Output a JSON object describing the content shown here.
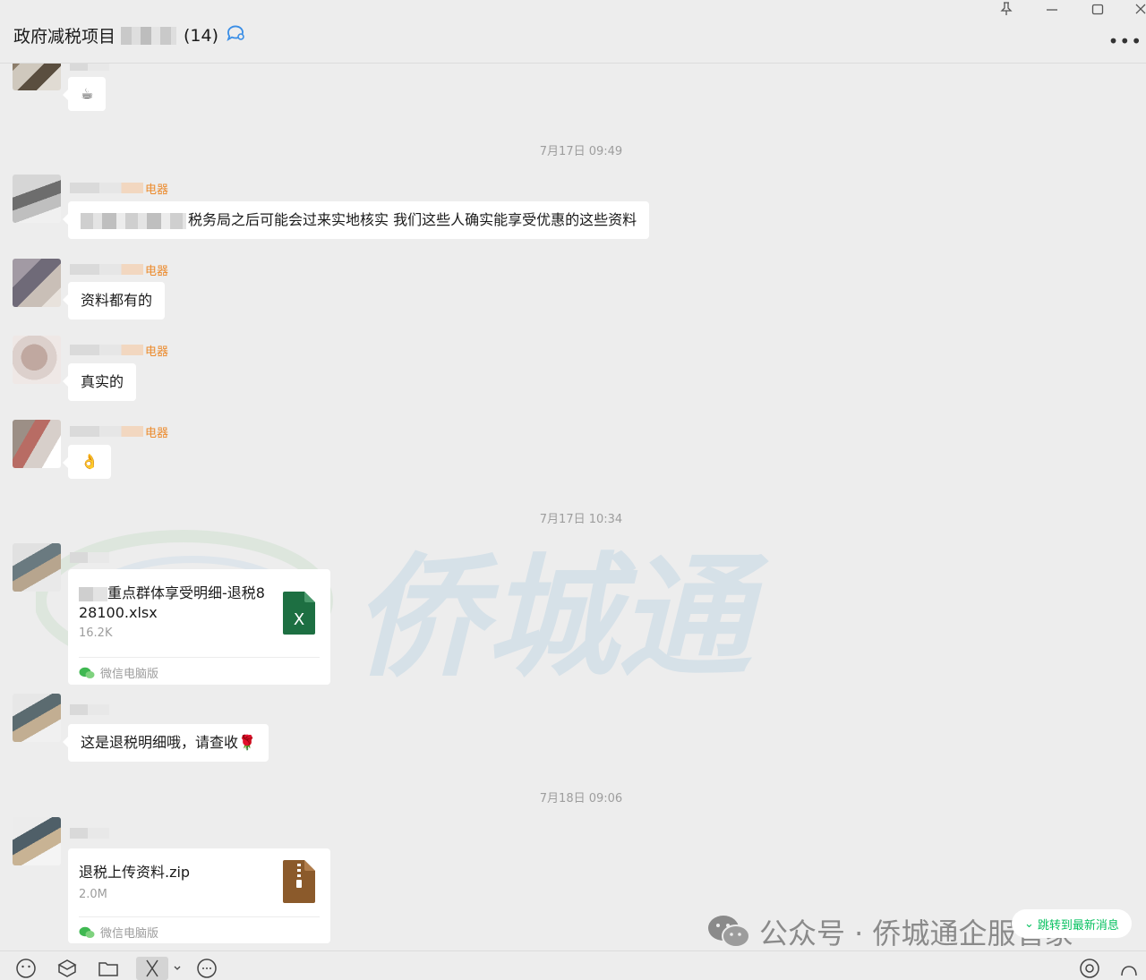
{
  "header": {
    "title_prefix": "政府减税项目",
    "member_count": "(14)"
  },
  "messages": [
    {
      "type": "emoji",
      "content": "☕"
    },
    {
      "type": "timestamp",
      "text": "7月17日 09:49"
    },
    {
      "type": "text",
      "nickname_suffix": "电器",
      "content": "税务局之后可能会过来实地核实 我们这些人确实能享受优惠的这些资料"
    },
    {
      "type": "text",
      "nickname_suffix": "电器",
      "content": "资料都有的"
    },
    {
      "type": "text",
      "nickname_suffix": "电器",
      "content": "真实的"
    },
    {
      "type": "emoji",
      "nickname_suffix": "电器",
      "content": "👌"
    },
    {
      "type": "timestamp",
      "text": "7月17日 10:34"
    },
    {
      "type": "file",
      "file_name": "重点群体享受明细-退税828100.xlsx",
      "file_size": "16.2K",
      "source": "微信电脑版",
      "file_type": "excel-icon",
      "file_badge": "X"
    },
    {
      "type": "text",
      "content": "这是退税明细哦，请查收🌹"
    },
    {
      "type": "timestamp",
      "text": "7月18日 09:06"
    },
    {
      "type": "file",
      "file_name": "退税上传资料.zip",
      "file_size": "2.0M",
      "source": "微信电脑版",
      "file_type": "zip-icon"
    }
  ],
  "watermark": {
    "text": "侨城通",
    "logo": "QCT"
  },
  "footer": {
    "public_account": "公众号 · 侨城通企服管家",
    "jump_latest": "跳转到最新消息"
  },
  "colors": {
    "background": "#ededed",
    "nickname": "#ec8a2c",
    "excel": "#1d6f42",
    "zip": "#8b5a2b",
    "wechat_green": "#07c160"
  }
}
